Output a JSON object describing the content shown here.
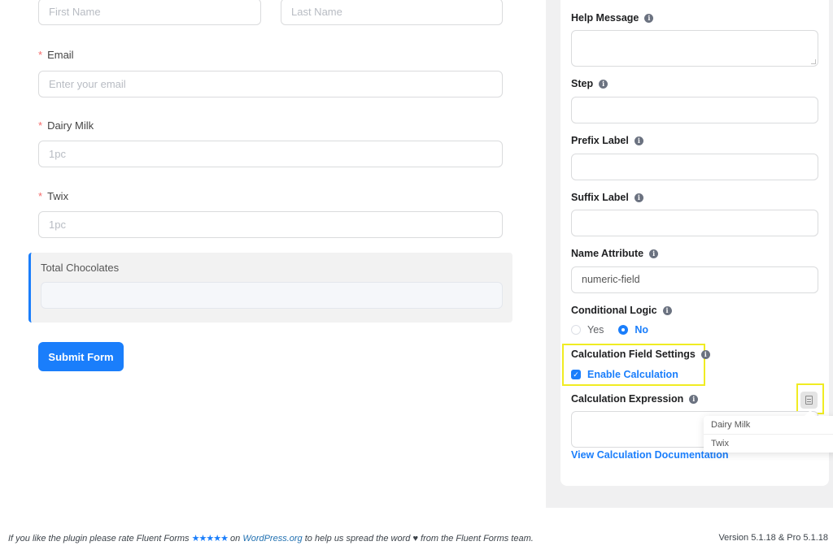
{
  "form": {
    "first_name_placeholder": "First Name",
    "last_name_placeholder": "Last Name",
    "email": {
      "label": "Email",
      "required_mark": "*",
      "placeholder": "Enter your email"
    },
    "dairy_milk": {
      "label": "Dairy Milk",
      "required_mark": "*",
      "placeholder": "1pc"
    },
    "twix": {
      "label": "Twix",
      "required_mark": "*",
      "placeholder": "1pc"
    },
    "total": {
      "label": "Total Chocolates",
      "value": ""
    },
    "submit_label": "Submit Form"
  },
  "settings": {
    "help_message": {
      "label": "Help Message",
      "value": ""
    },
    "step": {
      "label": "Step",
      "value": ""
    },
    "prefix_label": {
      "label": "Prefix Label",
      "value": ""
    },
    "suffix_label": {
      "label": "Suffix Label",
      "value": ""
    },
    "name_attribute": {
      "label": "Name Attribute",
      "value": "numeric-field"
    },
    "conditional_logic": {
      "label": "Conditional Logic",
      "options": [
        "Yes",
        "No"
      ],
      "selected": "No"
    },
    "calc_field_settings": {
      "label": "Calculation Field Settings",
      "enable_label": "Enable Calculation",
      "enabled": true
    },
    "calc_expression": {
      "label": "Calculation Expression",
      "value": ""
    },
    "doc_link": "View Calculation Documentation",
    "field_picker_options": [
      "Dairy Milk",
      "Twix"
    ],
    "info_glyph": "i"
  },
  "footer": {
    "text_1": "If you like the plugin please rate Fluent Forms",
    "stars": "★★★★★",
    "text_2": "on",
    "link": "WordPress.org",
    "text_3": "to help us spread the word",
    "heart": "♥",
    "text_4": "from the Fluent Forms team.",
    "version": "Version 5.1.18 & Pro 5.1.18"
  },
  "colors": {
    "primary": "#1a7efb",
    "required": "#f56c6c",
    "highlight": "#f0ec22"
  }
}
